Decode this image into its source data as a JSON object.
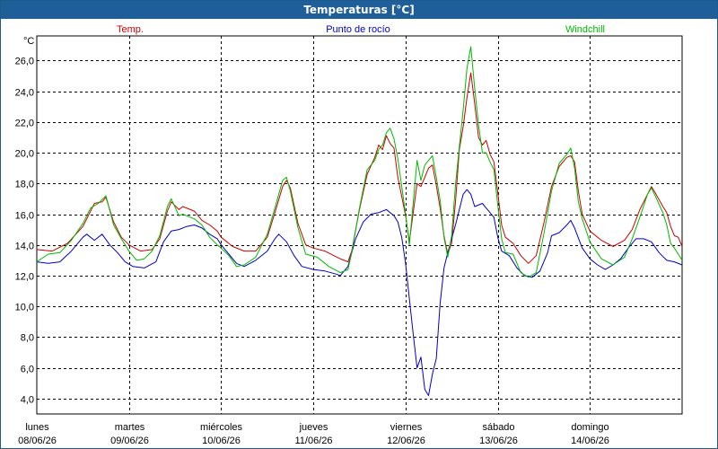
{
  "window": {
    "title": "Temperaturas [°C]"
  },
  "chart_data": {
    "type": "line",
    "title": "Temperaturas [°C]",
    "ylabel": "°C",
    "ylim": [
      3.0,
      27.6
    ],
    "xlim": [
      0,
      168
    ],
    "yticks": [
      4.0,
      6.0,
      8.0,
      10.0,
      12.0,
      14.0,
      16.0,
      18.0,
      20.0,
      22.0,
      24.0,
      26.0
    ],
    "ytick_labels": [
      "4,0",
      "6,0",
      "8,0",
      "10,0",
      "12,0",
      "14,0",
      "16,0",
      "18,0",
      "20,0",
      "22,0",
      "24,0",
      "26,0"
    ],
    "xtick_hours": [
      0,
      24,
      48,
      72,
      96,
      120,
      144
    ],
    "xtick_days": [
      "lunes",
      "martes",
      "miércoles",
      "jueves",
      "viernes",
      "sábado",
      "domingo"
    ],
    "xtick_dates": [
      "08/06/26",
      "09/06/26",
      "10/06/26",
      "11/06/26",
      "12/06/26",
      "13/06/26",
      "14/06/26"
    ],
    "grid": true,
    "legend_placement": "top",
    "series": [
      {
        "name": "Temp.",
        "color": "#cc0000",
        "points": [
          [
            0,
            13.7
          ],
          [
            4,
            13.6
          ],
          [
            8,
            14.1
          ],
          [
            12,
            15.2
          ],
          [
            14,
            16.2
          ],
          [
            15,
            16.7
          ],
          [
            17,
            16.8
          ],
          [
            18,
            17.1
          ],
          [
            20,
            15.5
          ],
          [
            22,
            14.5
          ],
          [
            24,
            14.0
          ],
          [
            27,
            13.6
          ],
          [
            30,
            13.7
          ],
          [
            32,
            14.4
          ],
          [
            34,
            16.2
          ],
          [
            35,
            16.8
          ],
          [
            37,
            16.3
          ],
          [
            38,
            16.5
          ],
          [
            41,
            16.2
          ],
          [
            43,
            15.6
          ],
          [
            45,
            15.3
          ],
          [
            47,
            14.9
          ],
          [
            48,
            14.5
          ],
          [
            51,
            13.9
          ],
          [
            54,
            13.6
          ],
          [
            57,
            13.6
          ],
          [
            60,
            14.5
          ],
          [
            62,
            16.1
          ],
          [
            64,
            17.8
          ],
          [
            65,
            18.2
          ],
          [
            66,
            17.7
          ],
          [
            68,
            15.4
          ],
          [
            70,
            14.0
          ],
          [
            72,
            13.8
          ],
          [
            75,
            13.6
          ],
          [
            79,
            13.1
          ],
          [
            81,
            12.9
          ],
          [
            82,
            13.6
          ],
          [
            84,
            16.3
          ],
          [
            86,
            18.6
          ],
          [
            88,
            19.7
          ],
          [
            89,
            20.5
          ],
          [
            90,
            20.2
          ],
          [
            91,
            21.1
          ],
          [
            92,
            20.6
          ],
          [
            93,
            20.3
          ],
          [
            94,
            18.4
          ],
          [
            96,
            15.9
          ],
          [
            97,
            14.2
          ],
          [
            99,
            18.0
          ],
          [
            100,
            17.8
          ],
          [
            101,
            18.4
          ],
          [
            102,
            19.0
          ],
          [
            103,
            19.2
          ],
          [
            104,
            17.9
          ],
          [
            105,
            16.4
          ],
          [
            106,
            14.6
          ],
          [
            107,
            13.4
          ],
          [
            108,
            14.1
          ],
          [
            109,
            16.8
          ],
          [
            110,
            20.2
          ],
          [
            111,
            21.7
          ],
          [
            112,
            23.6
          ],
          [
            113,
            25.2
          ],
          [
            114,
            23.2
          ],
          [
            115,
            21.0
          ],
          [
            116,
            20.5
          ],
          [
            117,
            20.8
          ],
          [
            118,
            19.9
          ],
          [
            119,
            19.4
          ],
          [
            120,
            17.4
          ],
          [
            121,
            15.3
          ],
          [
            122,
            14.5
          ],
          [
            124,
            14.1
          ],
          [
            126,
            13.3
          ],
          [
            128,
            12.8
          ],
          [
            130,
            13.3
          ],
          [
            132,
            15.4
          ],
          [
            134,
            17.8
          ],
          [
            136,
            19.1
          ],
          [
            138,
            19.7
          ],
          [
            139,
            19.8
          ],
          [
            140,
            19.4
          ],
          [
            141,
            17.5
          ],
          [
            142,
            16.0
          ],
          [
            144,
            14.9
          ],
          [
            147,
            14.3
          ],
          [
            150,
            13.9
          ],
          [
            153,
            14.3
          ],
          [
            155,
            15.0
          ],
          [
            157,
            16.3
          ],
          [
            159,
            17.3
          ],
          [
            160,
            17.8
          ],
          [
            161,
            17.4
          ],
          [
            163,
            16.5
          ],
          [
            164,
            16.1
          ],
          [
            165,
            15.2
          ],
          [
            166,
            14.6
          ],
          [
            167,
            14.5
          ],
          [
            168,
            13.9
          ]
        ]
      },
      {
        "name": "Punto de rocío",
        "color": "#0000cc",
        "points": [
          [
            0,
            12.9
          ],
          [
            3,
            12.8
          ],
          [
            6,
            12.9
          ],
          [
            9,
            13.6
          ],
          [
            12,
            14.5
          ],
          [
            13,
            14.7
          ],
          [
            15,
            14.3
          ],
          [
            17,
            14.7
          ],
          [
            19,
            14.0
          ],
          [
            21,
            13.5
          ],
          [
            23,
            12.9
          ],
          [
            25,
            12.6
          ],
          [
            28,
            12.5
          ],
          [
            31,
            12.9
          ],
          [
            33,
            14.2
          ],
          [
            35,
            14.9
          ],
          [
            37,
            15.0
          ],
          [
            39,
            15.2
          ],
          [
            41,
            15.3
          ],
          [
            43,
            15.1
          ],
          [
            45,
            14.7
          ],
          [
            47,
            14.4
          ],
          [
            48,
            14.0
          ],
          [
            50,
            13.4
          ],
          [
            52,
            12.8
          ],
          [
            54,
            12.6
          ],
          [
            57,
            13.0
          ],
          [
            60,
            13.6
          ],
          [
            62,
            14.4
          ],
          [
            63,
            14.7
          ],
          [
            65,
            14.2
          ],
          [
            67,
            13.3
          ],
          [
            69,
            12.6
          ],
          [
            72,
            12.4
          ],
          [
            75,
            12.3
          ],
          [
            78,
            12.1
          ],
          [
            79,
            12.0
          ],
          [
            81,
            12.6
          ],
          [
            83,
            14.4
          ],
          [
            85,
            15.5
          ],
          [
            87,
            16.0
          ],
          [
            89,
            16.1
          ],
          [
            91,
            16.3
          ],
          [
            93,
            15.9
          ],
          [
            94,
            15.5
          ],
          [
            95,
            14.5
          ],
          [
            96,
            12.8
          ],
          [
            97,
            10.5
          ],
          [
            98,
            8.2
          ],
          [
            99,
            6.0
          ],
          [
            100,
            6.7
          ],
          [
            101,
            4.6
          ],
          [
            102,
            4.2
          ],
          [
            103,
            5.6
          ],
          [
            104,
            6.6
          ],
          [
            105,
            10.2
          ],
          [
            106,
            12.5
          ],
          [
            107,
            13.5
          ],
          [
            108,
            14.4
          ],
          [
            109,
            15.3
          ],
          [
            110,
            16.3
          ],
          [
            111,
            17.3
          ],
          [
            112,
            17.6
          ],
          [
            113,
            17.3
          ],
          [
            114,
            16.5
          ],
          [
            116,
            16.7
          ],
          [
            117,
            16.4
          ],
          [
            119,
            15.8
          ],
          [
            120,
            14.5
          ],
          [
            121,
            13.6
          ],
          [
            123,
            13.3
          ],
          [
            125,
            12.5
          ],
          [
            127,
            12.0
          ],
          [
            129,
            11.9
          ],
          [
            131,
            12.3
          ],
          [
            133,
            13.5
          ],
          [
            134,
            14.6
          ],
          [
            136,
            14.8
          ],
          [
            138,
            15.3
          ],
          [
            139,
            15.6
          ],
          [
            140,
            15.1
          ],
          [
            142,
            13.8
          ],
          [
            144,
            13.1
          ],
          [
            146,
            12.7
          ],
          [
            148,
            12.4
          ],
          [
            150,
            12.7
          ],
          [
            152,
            13.1
          ],
          [
            154,
            13.8
          ],
          [
            156,
            14.4
          ],
          [
            158,
            14.4
          ],
          [
            160,
            14.2
          ],
          [
            162,
            13.5
          ],
          [
            164,
            13.0
          ],
          [
            166,
            12.9
          ],
          [
            168,
            12.7
          ]
        ]
      },
      {
        "name": "Windchill",
        "color": "#00bb00",
        "points": [
          [
            0,
            12.9
          ],
          [
            3,
            13.4
          ],
          [
            6,
            13.5
          ],
          [
            9,
            14.3
          ],
          [
            12,
            15.4
          ],
          [
            14,
            16.4
          ],
          [
            16,
            16.7
          ],
          [
            18,
            17.2
          ],
          [
            20,
            15.3
          ],
          [
            22,
            14.4
          ],
          [
            24,
            13.6
          ],
          [
            26,
            13.0
          ],
          [
            28,
            13.1
          ],
          [
            30,
            13.6
          ],
          [
            32,
            14.6
          ],
          [
            34,
            16.5
          ],
          [
            35,
            17.0
          ],
          [
            37,
            15.9
          ],
          [
            38,
            16.0
          ],
          [
            41,
            15.7
          ],
          [
            43,
            15.3
          ],
          [
            45,
            14.5
          ],
          [
            47,
            14.0
          ],
          [
            48,
            13.8
          ],
          [
            50,
            13.3
          ],
          [
            52,
            12.6
          ],
          [
            54,
            12.7
          ],
          [
            57,
            13.2
          ],
          [
            60,
            14.7
          ],
          [
            62,
            16.4
          ],
          [
            64,
            18.2
          ],
          [
            65,
            18.4
          ],
          [
            66,
            17.5
          ],
          [
            68,
            15.1
          ],
          [
            70,
            13.4
          ],
          [
            73,
            13.2
          ],
          [
            76,
            12.6
          ],
          [
            79,
            12.2
          ],
          [
            81,
            12.4
          ],
          [
            82,
            13.5
          ],
          [
            84,
            16.4
          ],
          [
            86,
            18.9
          ],
          [
            88,
            19.5
          ],
          [
            89,
            20.2
          ],
          [
            90,
            20.5
          ],
          [
            91,
            21.3
          ],
          [
            92,
            21.6
          ],
          [
            93,
            20.9
          ],
          [
            94,
            19.6
          ],
          [
            96,
            16.0
          ],
          [
            97,
            14.0
          ],
          [
            99,
            19.5
          ],
          [
            100,
            18.2
          ],
          [
            101,
            19.2
          ],
          [
            102,
            19.5
          ],
          [
            103,
            19.8
          ],
          [
            104,
            18.4
          ],
          [
            105,
            16.9
          ],
          [
            106,
            14.5
          ],
          [
            107,
            13.2
          ],
          [
            108,
            14.6
          ],
          [
            109,
            17.9
          ],
          [
            110,
            20.4
          ],
          [
            111,
            22.8
          ],
          [
            112,
            25.5
          ],
          [
            113,
            26.9
          ],
          [
            114,
            24.2
          ],
          [
            115,
            21.8
          ],
          [
            116,
            20.0
          ],
          [
            117,
            20.0
          ],
          [
            118,
            19.4
          ],
          [
            119,
            18.9
          ],
          [
            120,
            16.6
          ],
          [
            121,
            14.4
          ],
          [
            122,
            13.5
          ],
          [
            124,
            13.4
          ],
          [
            126,
            12.2
          ],
          [
            128,
            11.9
          ],
          [
            130,
            12.2
          ],
          [
            132,
            14.7
          ],
          [
            134,
            17.5
          ],
          [
            136,
            19.3
          ],
          [
            138,
            19.9
          ],
          [
            139,
            20.3
          ],
          [
            140,
            19.0
          ],
          [
            141,
            16.8
          ],
          [
            142,
            15.7
          ],
          [
            144,
            14.2
          ],
          [
            147,
            13.1
          ],
          [
            150,
            12.7
          ],
          [
            153,
            13.2
          ],
          [
            155,
            14.4
          ],
          [
            157,
            15.8
          ],
          [
            159,
            17.3
          ],
          [
            160,
            17.7
          ],
          [
            161,
            17.2
          ],
          [
            163,
            16.1
          ],
          [
            164,
            15.3
          ],
          [
            165,
            14.1
          ],
          [
            166,
            13.8
          ],
          [
            167,
            13.4
          ],
          [
            168,
            13.0
          ]
        ]
      }
    ]
  }
}
